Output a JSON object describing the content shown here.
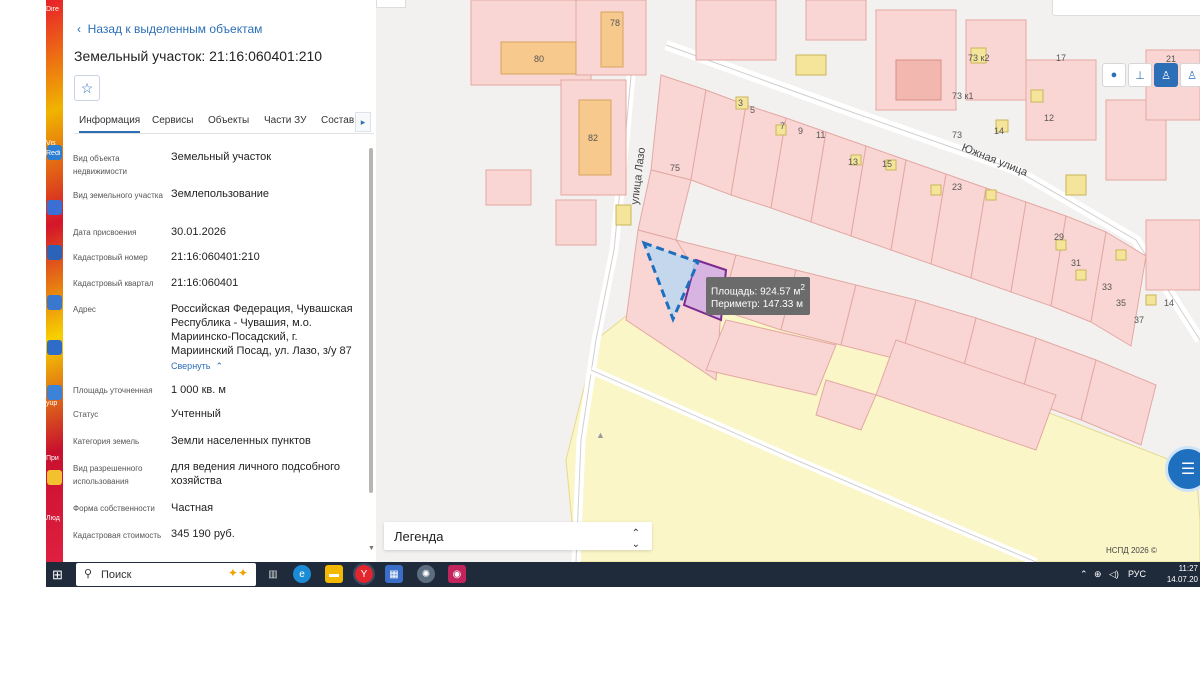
{
  "panel": {
    "back_link": "Назад к выделенным объектам",
    "title": "Земельный участок: 21:16:060401:210",
    "tabs": [
      {
        "label": "Информация"
      },
      {
        "label": "Сервисы"
      },
      {
        "label": "Объекты"
      },
      {
        "label": "Части ЗУ"
      },
      {
        "label": "Состав"
      }
    ],
    "info": [
      {
        "label": "Вид объекта недвижимости",
        "value": "Земельный участок"
      },
      {
        "label": "Вид земельного участка",
        "value": "Землепользование"
      },
      {
        "label": "Дата присвоения",
        "value": "30.01.2026"
      },
      {
        "label": "Кадастровый номер",
        "value": "21:16:060401:210"
      },
      {
        "label": "Кадастровый квартал",
        "value": "21:16:060401"
      },
      {
        "label": "Адрес",
        "value": "Российская Федерация, Чувашская Республика - Чувашия, м.о. Мариинско-Посадский, г. Мариинский Посад, ул. Лазо, з/у 87"
      },
      {
        "label": "Площадь уточненная",
        "value": "1 000 кв. м"
      },
      {
        "label": "Статус",
        "value": "Учтенный"
      },
      {
        "label": "Категория земель",
        "value": "Земли населенных пунктов"
      },
      {
        "label": "Вид разрешенного использования",
        "value": "для ведения личного подсобного хозяйства"
      },
      {
        "label": "Форма собственности",
        "value": "Частная"
      },
      {
        "label": "Кадастровая стоимость",
        "value": "345 190 руб."
      }
    ],
    "collapse_link": "Свернуть"
  },
  "map": {
    "street_lazo": "улица Лазо",
    "street_yuzhnaya": "Южная улица",
    "house_numbers": [
      "80",
      "78",
      "82",
      "75",
      "3",
      "5",
      "7",
      "9",
      "11",
      "13",
      "15",
      "23",
      "73 к2",
      "73 к1",
      "73",
      "14",
      "12",
      "17",
      "21",
      "29",
      "31",
      "33",
      "35",
      "37",
      "14"
    ],
    "measure": {
      "area_label": "Площадь:",
      "area_value": "924.57 м",
      "area_sup": "2",
      "perimeter_label": "Периметр:",
      "perimeter_value": "147.33 м"
    },
    "legend": "Легенда",
    "copyright": "НСПД 2026 ©"
  },
  "taskbar": {
    "search_placeholder": "Поиск",
    "lang": "РУС",
    "time": "11:27",
    "date": "14.07.20"
  },
  "desktop": {
    "labels": [
      "Dire",
      "Vis",
      "Redi",
      "yup",
      "При",
      "Люд"
    ]
  }
}
